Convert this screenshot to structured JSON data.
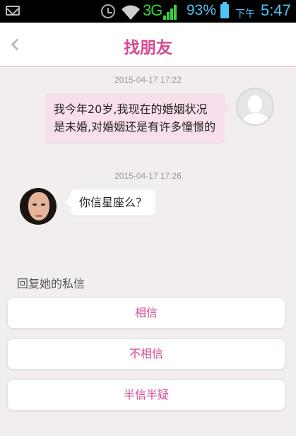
{
  "status_bar": {
    "network": "3G",
    "battery_percent": "93%",
    "am_pm": "下午",
    "time": "5:47",
    "icons": [
      "mail-icon",
      "alarm-icon",
      "wifi-icon",
      "signal-icon",
      "battery-icon"
    ],
    "accent_color": "#4fc3f7",
    "network_color": "#37d13a"
  },
  "header": {
    "title": "找朋友",
    "back_icon": "chevron-left-icon",
    "title_color": "#d64a94"
  },
  "messages": [
    {
      "timestamp": "2015-04-17 17:22",
      "direction": "outgoing",
      "text": "我今年20岁,我现在的婚姻状况是未婚,对婚姻还是有许多憧憬的"
    },
    {
      "timestamp": "2015-04-17 17:26",
      "direction": "incoming",
      "text": "你信星座么？"
    }
  ],
  "reply": {
    "label": "回复她的私信",
    "options": [
      "相信",
      "不相信",
      "半信半疑"
    ]
  }
}
